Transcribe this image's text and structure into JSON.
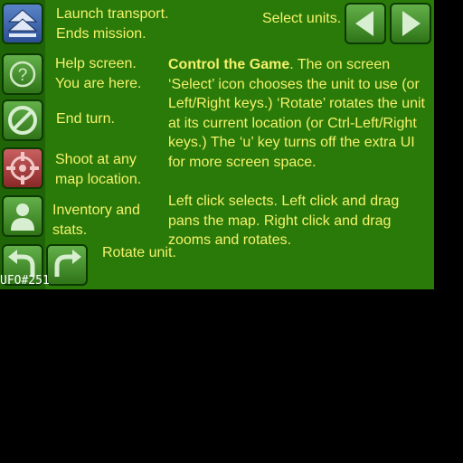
{
  "buttons": {
    "launch": {
      "label_line1": "Launch transport.",
      "label_line2": "Ends mission.",
      "icon": "chevron-up-icon"
    },
    "help": {
      "label_line1": "Help screen.",
      "label_line2": "You are here.",
      "icon": "question-icon"
    },
    "end_turn": {
      "label": "End turn.",
      "icon": "no-sign-icon"
    },
    "shoot": {
      "label_line1": "Shoot at any",
      "label_line2": "map location.",
      "icon": "crosshair-icon"
    },
    "inventory": {
      "label_line1": "Inventory and",
      "label_line2": "stats.",
      "icon": "person-icon"
    },
    "rotate": {
      "label": "Rotate unit.",
      "icon_left": "rotate-left-icon",
      "icon_right": "rotate-right-icon"
    },
    "select": {
      "label": "Select units.",
      "icon_prev": "arrow-left-icon",
      "icon_next": "arrow-right-icon"
    }
  },
  "help_text": {
    "heading": "Control the Game",
    "paragraph1": ". The on screen ‘Select’ icon chooses the unit to use (or Left/Right keys.) ‘Rotate’ rotates the unit at its current location (or Ctrl-Left/Right keys.) The ‘u’ key turns off the extra UI for more screen space.",
    "paragraph2": "Left click selects. Left click and drag pans the map. Right click and drag zooms and rotates."
  },
  "footer": {
    "build": "UFO#251"
  },
  "colors": {
    "panel": "#2a7a0a",
    "text": "#f4f26a",
    "button_blue": "#3f66ad",
    "button_green": "#4a9432",
    "button_red": "#a84444"
  }
}
